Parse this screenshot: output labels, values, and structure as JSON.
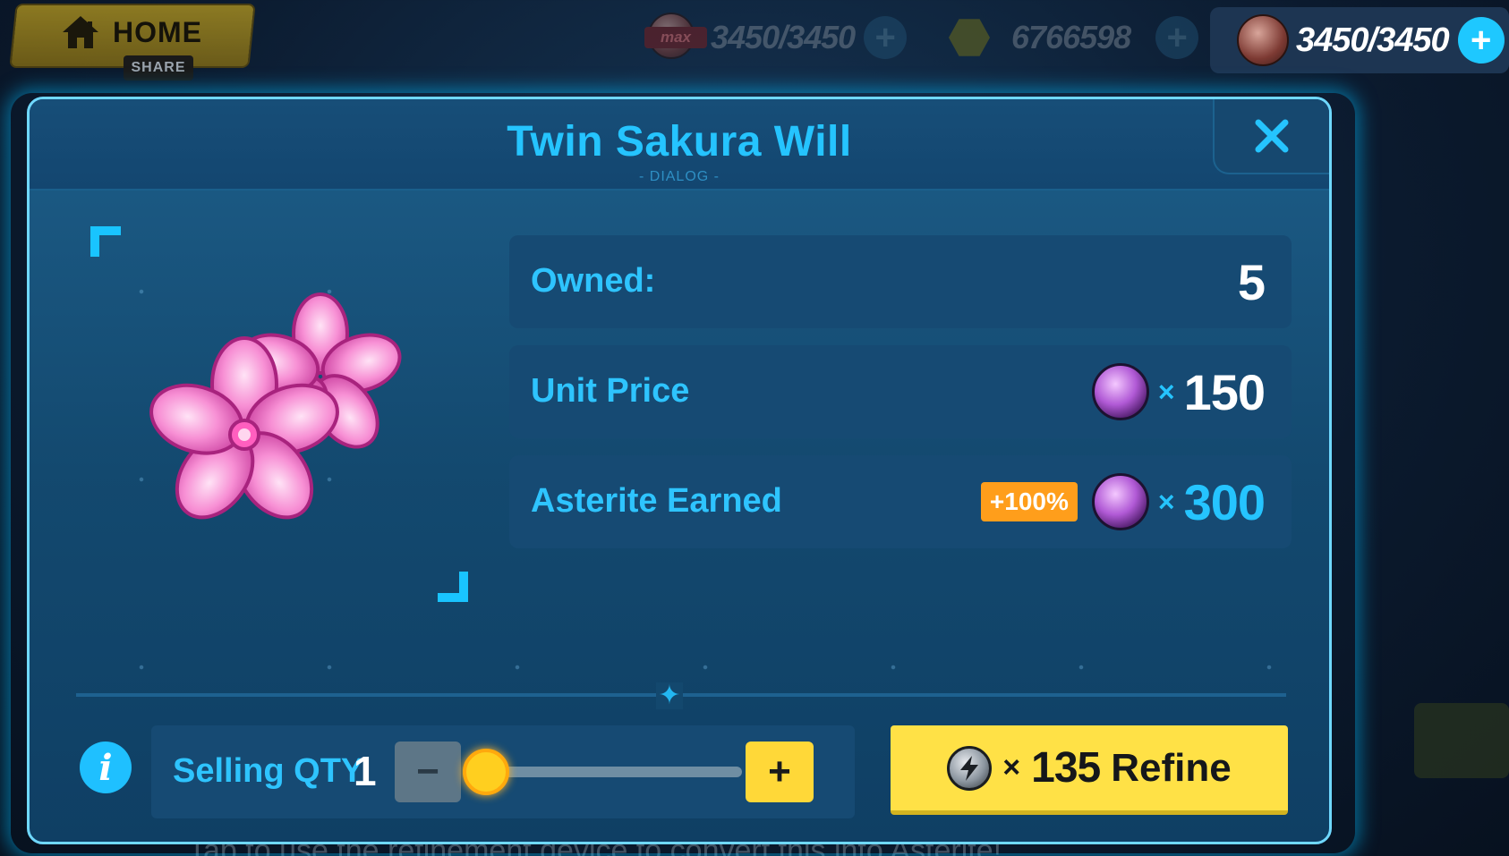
{
  "topbar": {
    "home_label": "HOME",
    "share_label": "SHARE",
    "stamina_max_tag": "max",
    "stamina_value": "3450/3450",
    "gold_value": "6766598",
    "energy_value": "3450/3450"
  },
  "dialog": {
    "title": "Twin Sakura Will",
    "subtitle": "- DIALOG -",
    "owned": {
      "label": "Owned:",
      "value": "5"
    },
    "unit_price": {
      "label": "Unit Price",
      "times": "×",
      "value": "150"
    },
    "asterite_earned": {
      "label": "Asterite Earned",
      "bonus": "+100%",
      "times": "×",
      "value": "300"
    },
    "selling": {
      "label": "Selling QTY",
      "quantity": "1",
      "minus_label": "−",
      "plus_label": "+",
      "slider_fraction": 0.0
    },
    "refine": {
      "times": "×",
      "cost": "135",
      "label": "Refine"
    }
  },
  "background": {
    "hint_text": "Tap to use the refinement device to convert this into Asterite!"
  },
  "colors": {
    "accent": "#25c4ff",
    "button_yellow": "#ffe146",
    "bonus_orange": "#ff9e1b",
    "panel": "#164a73"
  },
  "icons": [
    "home-icon",
    "stamina-coin-icon",
    "gold-icon",
    "energy-coin-icon",
    "plus-icon",
    "close-icon",
    "asterite-gem-icon",
    "info-icon",
    "refine-device-icon",
    "sakura-flower-icon",
    "divider-star-icon"
  ]
}
